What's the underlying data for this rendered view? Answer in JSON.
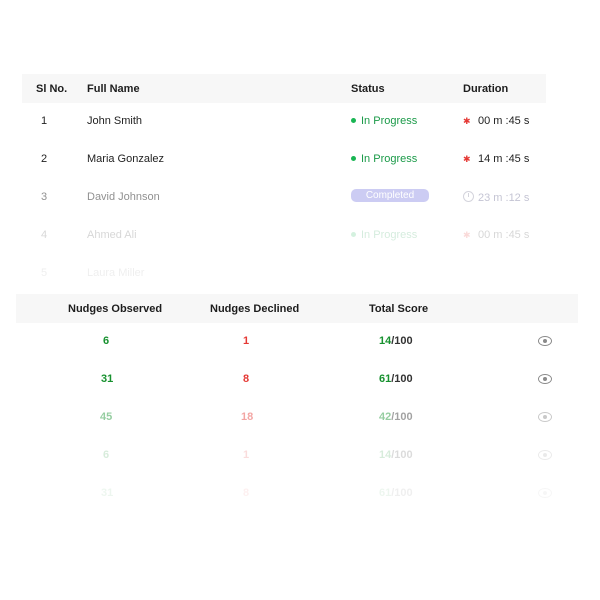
{
  "top_table": {
    "headers": {
      "sl_no": "Sl No.",
      "full_name": "Full Name",
      "status": "Status",
      "duration": "Duration"
    },
    "rows": [
      {
        "sl": "1",
        "name": "John Smith",
        "status": "In Progress",
        "duration": "00 m :45 s"
      },
      {
        "sl": "2",
        "name": "Maria Gonzalez",
        "status": "In Progress",
        "duration": "14 m :45 s"
      },
      {
        "sl": "3",
        "name": "David Johnson",
        "status": "Completed",
        "duration": "23 m :12 s"
      },
      {
        "sl": "4",
        "name": "Ahmed Ali",
        "status": "In Progress",
        "duration": "00 m :45 s"
      },
      {
        "sl": "5",
        "name": "Laura Miller",
        "status": "",
        "duration": ""
      }
    ]
  },
  "bottom_table": {
    "headers": {
      "observed": "Nudges Observed",
      "declined": "Nudges Declined",
      "score": "Total Score"
    },
    "rows": [
      {
        "observed": "6",
        "declined": "1",
        "score": "14",
        "total": "/100"
      },
      {
        "observed": "31",
        "declined": "8",
        "score": "61",
        "total": "/100"
      },
      {
        "observed": "45",
        "declined": "18",
        "score": "42",
        "total": "/100"
      },
      {
        "observed": "6",
        "declined": "1",
        "score": "14",
        "total": "/100"
      },
      {
        "observed": "31",
        "declined": "8",
        "score": "61",
        "total": "/100"
      }
    ]
  },
  "colors": {
    "in_progress": "#1a9a48",
    "completed_badge": "#9b9be8",
    "observed": "#17912f",
    "declined": "#e53935",
    "duration_marker": "#e53935"
  },
  "icons": {
    "row_action": "eye-icon",
    "status": "status-dot-icon",
    "duration": "clock-icon"
  }
}
